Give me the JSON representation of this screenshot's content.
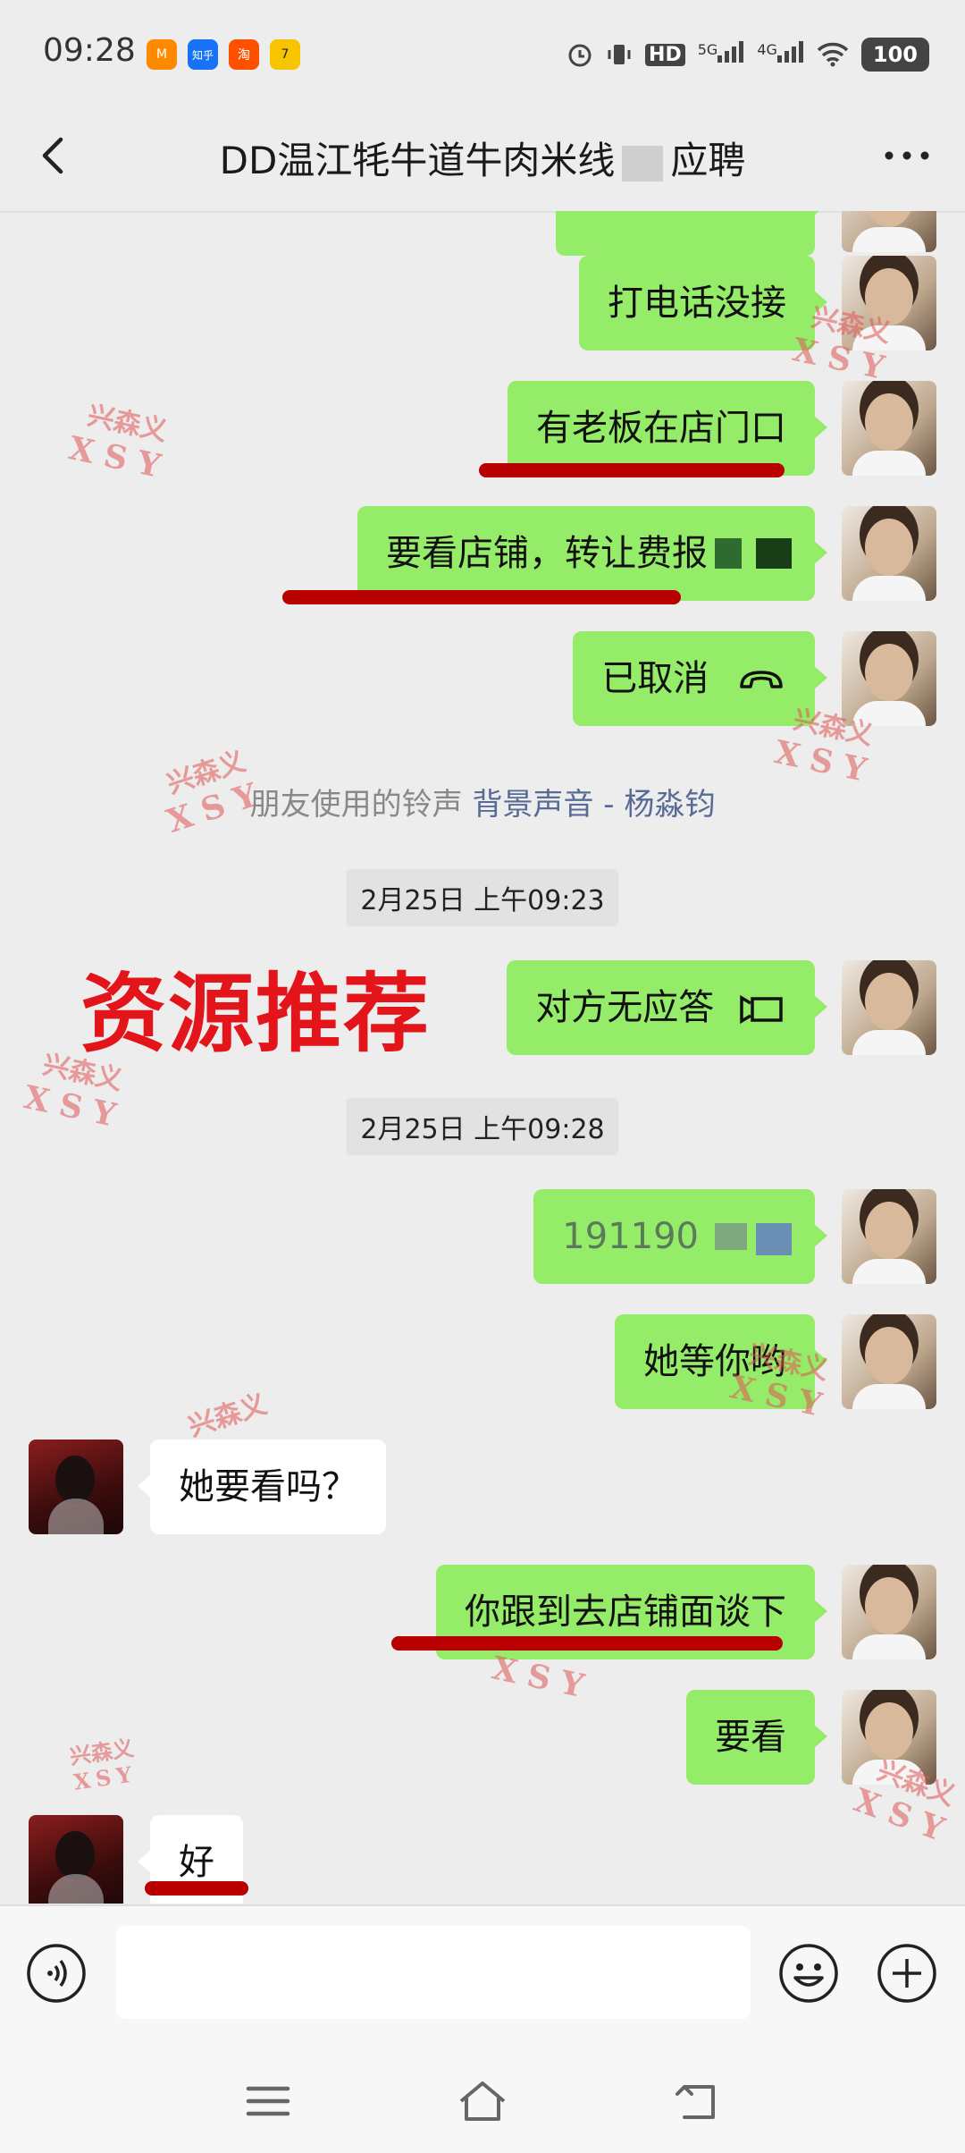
{
  "status_bar": {
    "time": "09:28",
    "apps": [
      {
        "name": "meituan-app-icon",
        "label": "M",
        "color": "#ff8a00"
      },
      {
        "name": "zhihu-app-icon",
        "label": "知乎",
        "color": "#1772f6"
      },
      {
        "name": "taobao-app-icon",
        "label": "淘",
        "color": "#ff5000"
      },
      {
        "name": "tiktok-app-icon",
        "label": "7",
        "color": "#f7c500"
      }
    ],
    "hd_label": "HD",
    "net_5g": "5G",
    "net_4g": "4G",
    "battery": "100"
  },
  "header": {
    "title": "DD温江牦牛道牛肉米线",
    "title_suffix": "应聘"
  },
  "messages": {
    "m1": "打电话没接",
    "m2": "有老板在店门口",
    "m3": "要看店铺，转让费报",
    "m4": "已取消",
    "ringtone_prefix": "朋友使用的铃声",
    "ringtone_song": "背景声音 - 杨淼钧",
    "ts1": "2月25日 上午09:23",
    "m5": "对方无应答",
    "ts2": "2月25日 上午09:28",
    "m6": "191190",
    "m7": "她等你哟",
    "m8": "她要看吗？",
    "m9": "你跟到去店铺面谈下",
    "m10": "要看",
    "m11": "好"
  },
  "overlay": {
    "promo_text": "资源推荐",
    "watermark_cn": "兴森义",
    "watermark_en": "XSY"
  },
  "input": {
    "placeholder": ""
  },
  "colors": {
    "my_bubble": "#95ec69",
    "other_bubble": "#ffffff",
    "background": "#ededed",
    "link": "#576b95",
    "underline": "#b80000",
    "promo": "#e4141b"
  }
}
